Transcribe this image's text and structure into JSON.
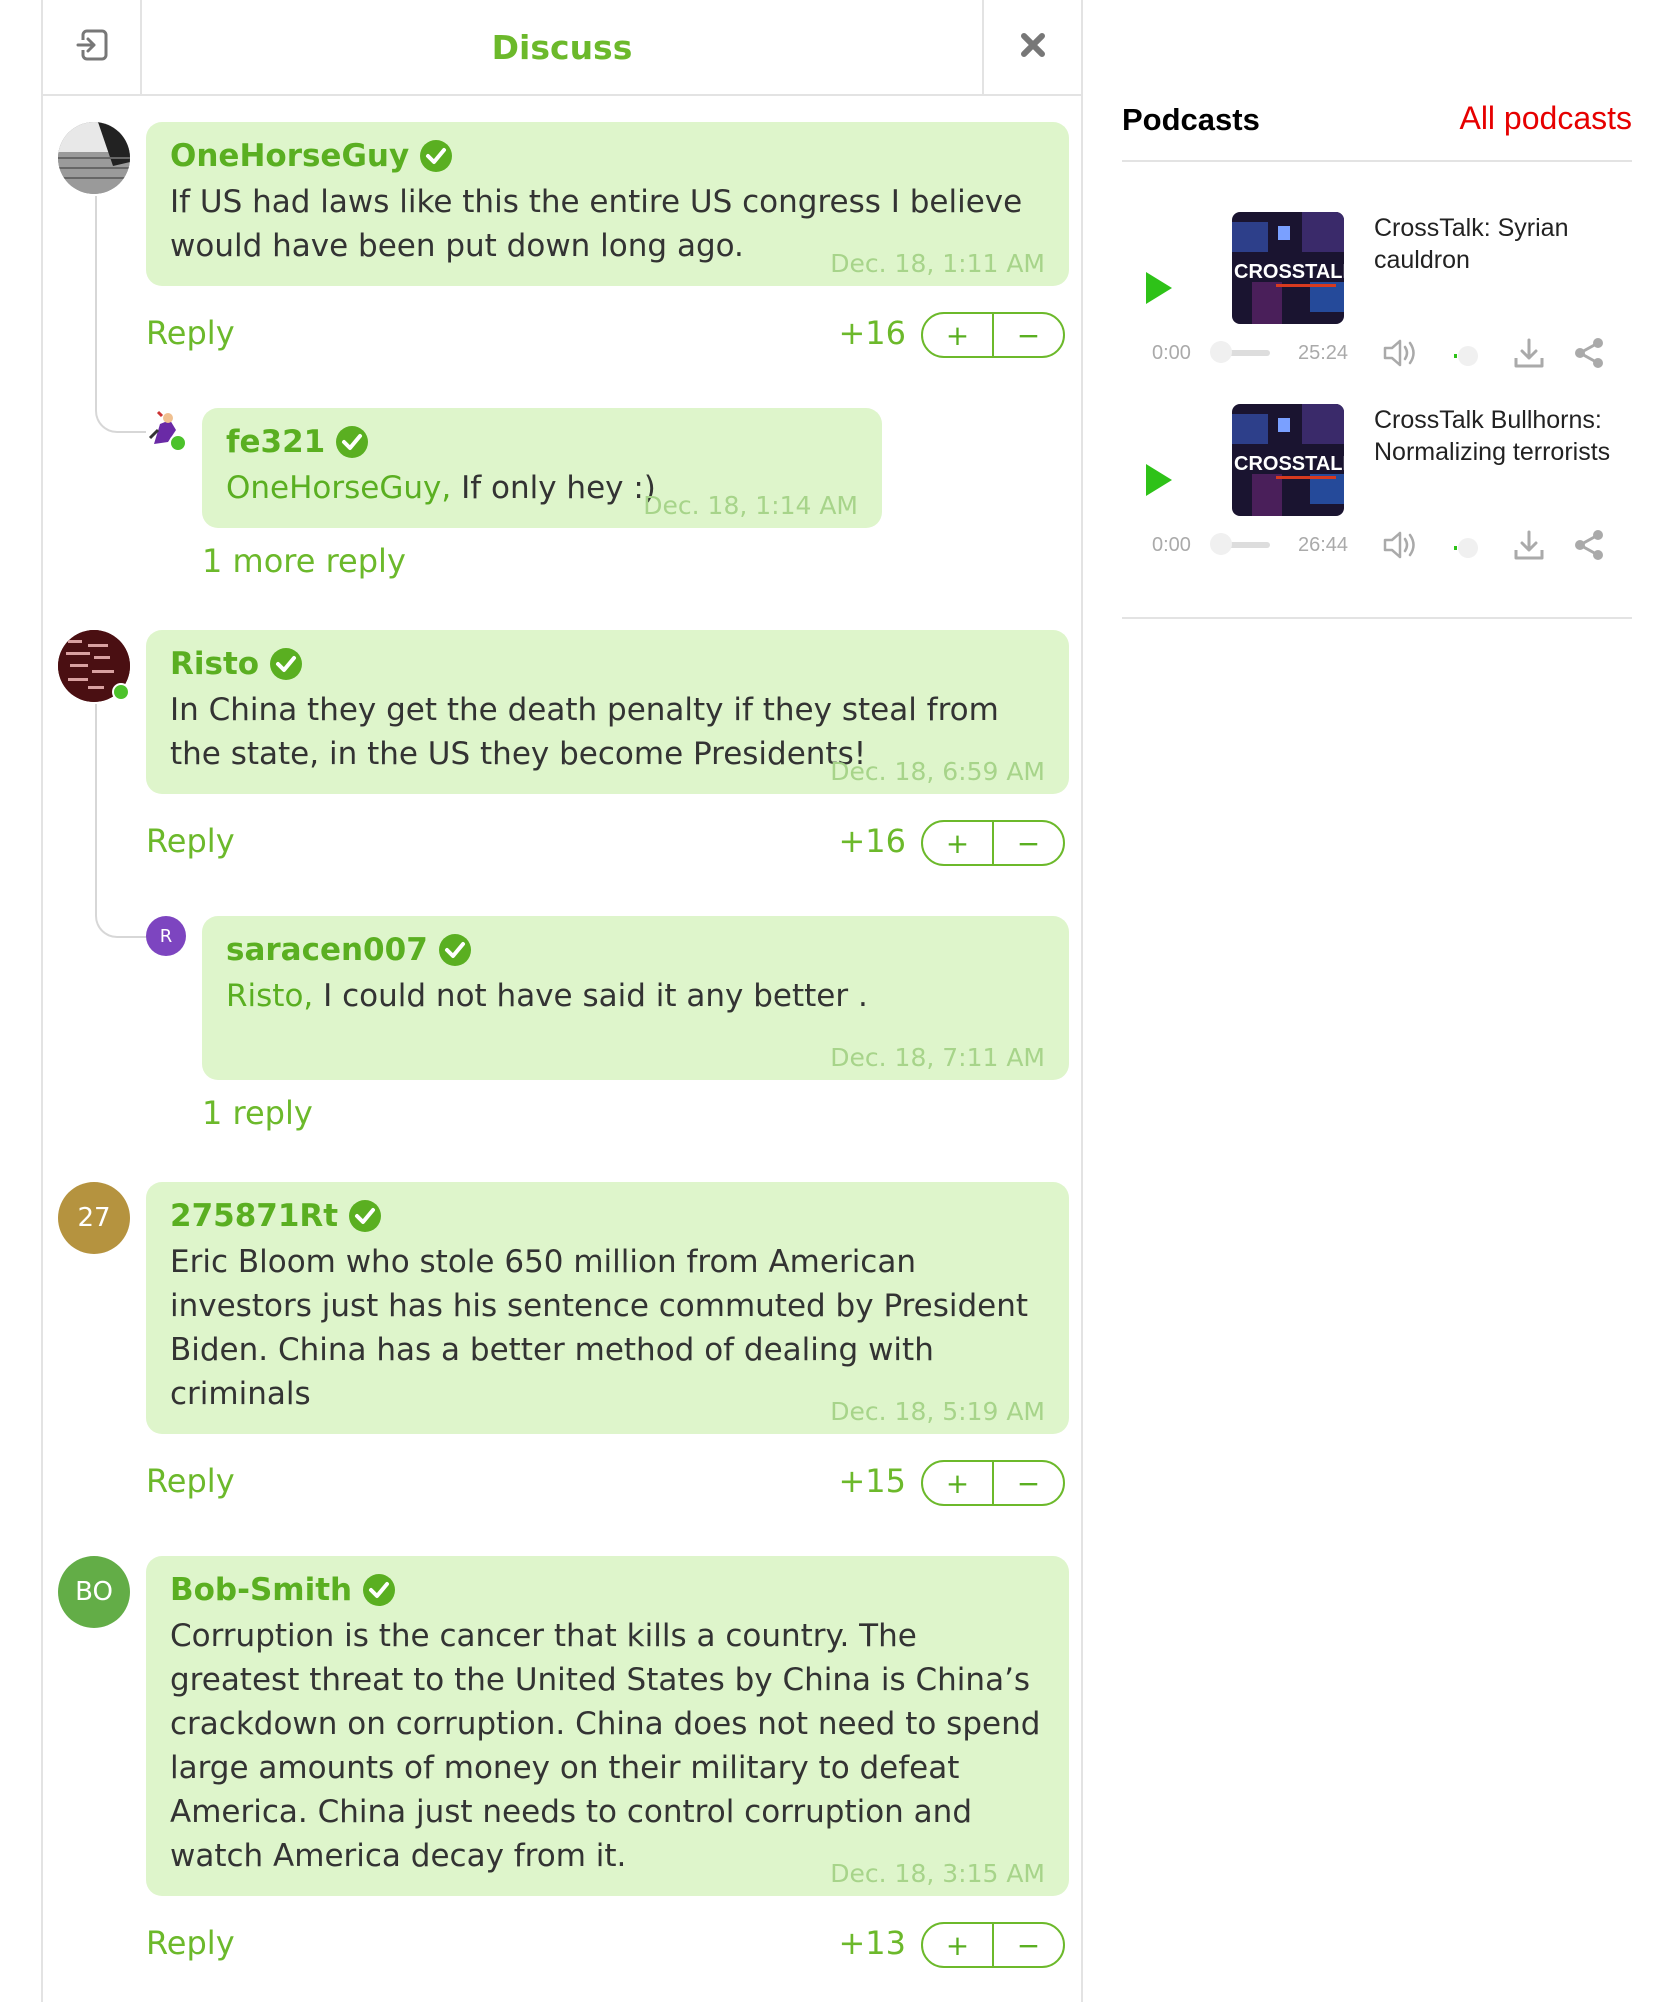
{
  "discuss": {
    "title": "Discuss",
    "comments": [
      {
        "author": "OneHorseGuy",
        "text": "If US had laws like this the entire US congress I believe would have been put down long ago.",
        "date": "Dec. 18, 1:11 AM",
        "reply": "Reply",
        "score": "+16",
        "replies": [
          {
            "author": "fe321",
            "mention": "OneHorseGuy,",
            "text": " If only hey :)",
            "date": "Dec. 18, 1:14 AM"
          }
        ],
        "more_replies": "1 more reply"
      },
      {
        "author": "Risto",
        "text": "In China they get the death penalty if they steal from the state, in the US they become Presidents!",
        "date": "Dec. 18, 6:59 AM",
        "reply": "Reply",
        "score": "+16",
        "replies": [
          {
            "author": "saracen007",
            "avatar_text": "R",
            "mention": "Risto,",
            "text": " I could not have said it any better .",
            "date": "Dec. 18, 7:11 AM"
          }
        ],
        "more_replies": "1 reply"
      },
      {
        "author": "275871Rt",
        "avatar_text": "27",
        "text": "Eric Bloom who stole 650 million from American investors just has his sentence commuted by President Biden. China has a better method of dealing with criminals",
        "date": "Dec. 18, 5:19 AM",
        "reply": "Reply",
        "score": "+15"
      },
      {
        "author": "Bob-Smith",
        "avatar_text": "BO",
        "text": "Corruption is the cancer that kills a country. The greatest threat to the United States by China is China’s crackdown on corruption. China does not need to spend large amounts of money on their military to defeat America. China just needs to control corruption and watch America decay from it.",
        "date": "Dec. 18, 3:15 AM",
        "reply": "Reply",
        "score": "+13"
      }
    ],
    "vote_plus": "+",
    "vote_minus": "−"
  },
  "podcasts": {
    "title": "Podcasts",
    "all_link": "All podcasts",
    "thumb_text": "CROSSTALK",
    "items": [
      {
        "title": "CrossTalk: Syrian cauldron",
        "current": "0:00",
        "duration": "25:24"
      },
      {
        "title": "CrossTalk Bullhorns: Normalizing terrorists",
        "current": "0:00",
        "duration": "26:44"
      }
    ]
  },
  "colors": {
    "accent": "#6cb92b",
    "bubble": "#def5cb",
    "podcast_link": "#e60000",
    "play": "#2ec218"
  },
  "icons": [
    "login-icon",
    "close-icon",
    "verified-icon",
    "play-icon",
    "volume-icon",
    "download-icon",
    "share-icon"
  ]
}
